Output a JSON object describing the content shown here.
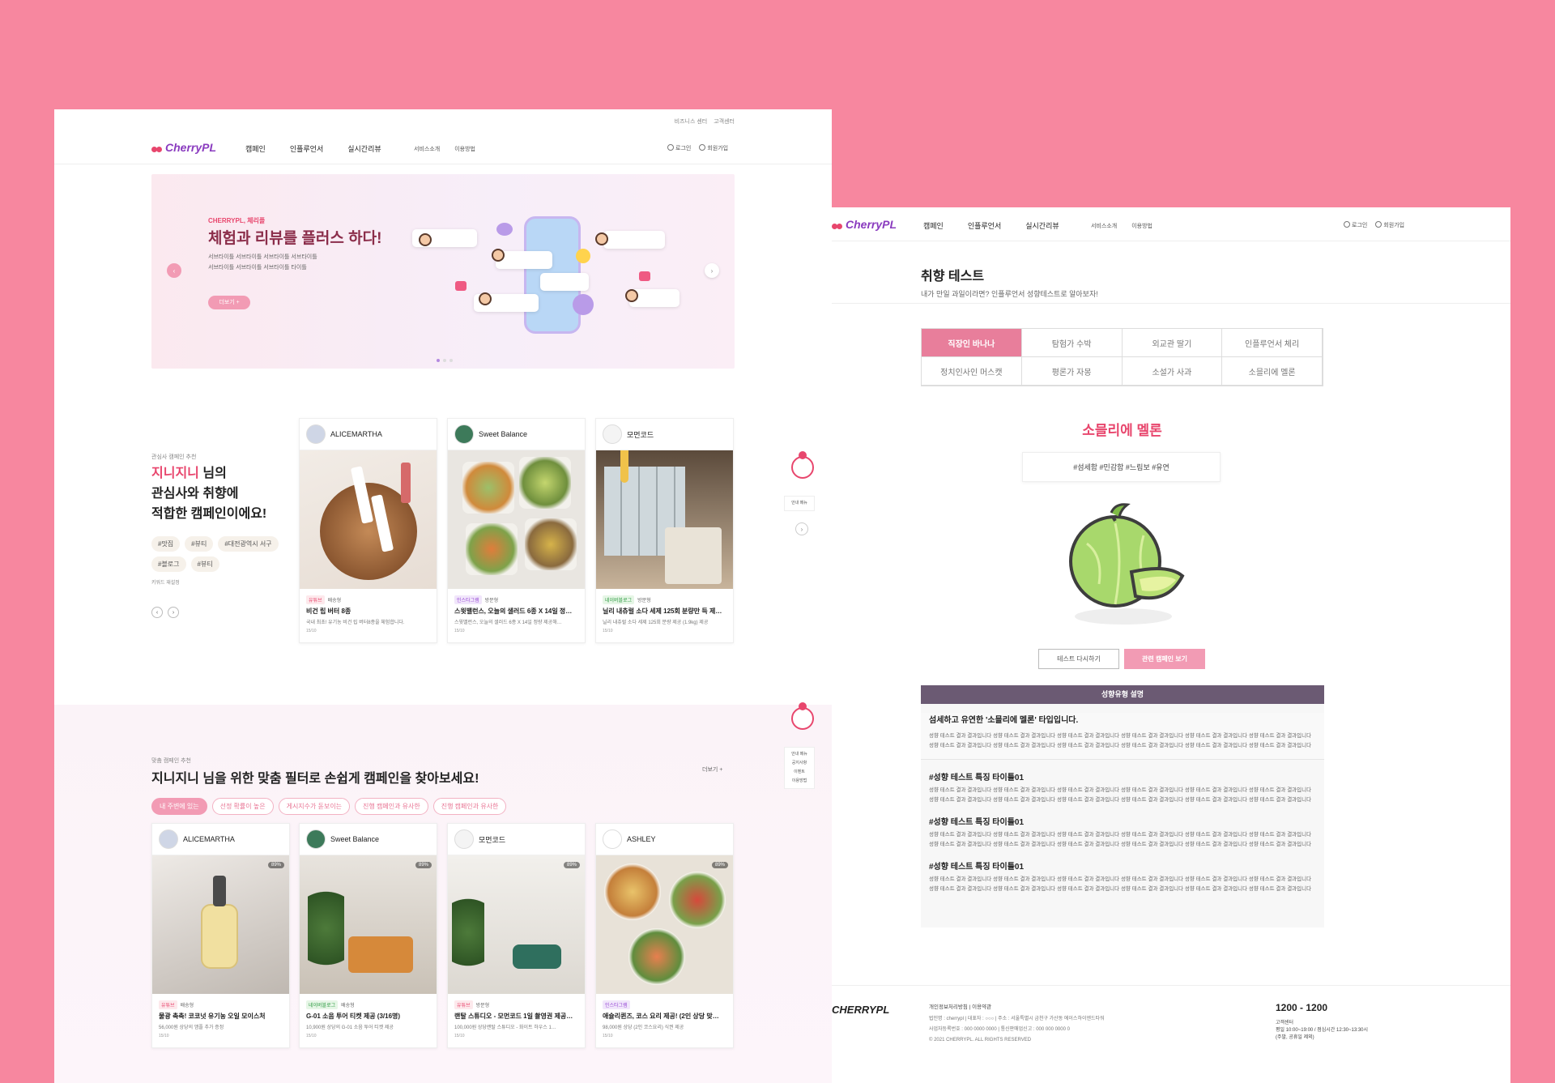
{
  "colors": {
    "background": "#f7879f",
    "accent": "#e8466d",
    "accent_light": "#f29bb4",
    "section_header": "#6b5a73"
  },
  "main_page": {
    "util_links": [
      "비즈니스 센터",
      "고객센터"
    ],
    "logo": "CherryPL",
    "nav": [
      "캠페인",
      "인플루언서",
      "실시간리뷰"
    ],
    "subnav": [
      "서비스소개",
      "이용방법"
    ],
    "auth": {
      "login": "로그인",
      "signup": "회원가입"
    },
    "banner": {
      "eyebrow": "CHERRYPL, 체리플",
      "title": "체험과 리뷰를 플러스 하다!",
      "desc_line1": "서브타이틀 서브타이틀 서브타이틀 서브타이틀",
      "desc_line2": "서브타이틀 서브타이틀 서브타이틀 타이틀",
      "more_button": "더보기 +"
    },
    "recommend": {
      "caption": "관심사 캠페인 추천",
      "name": "지니지니",
      "title_suffix": "님의",
      "title_line2": "관심사와 취향에",
      "title_line3": "적합한 캠페인이에요!",
      "chips": [
        "#맛집",
        "#뷰티",
        "#대전광역시 서구",
        "#블로그",
        "#뷰티"
      ],
      "reset_link": "키워드 재설정",
      "cards": [
        {
          "brand": "ALICEMARTHA",
          "badge": "유튜브",
          "type": "배송형",
          "title": "비건 립 버터 8종",
          "sub": "국내 최초! 유기농 비건 립 버터8종을 체험합니다.",
          "meta": "15/10"
        },
        {
          "brand": "Sweet Balance",
          "badge": "인스타그램",
          "type": "방문형",
          "title": "스윗밸런스, 오늘의 샐러드 6종 X 14일 정…",
          "sub": "스윗밸런스, 오늘의 샐러드 6종 X 14일 정량 제공해…",
          "meta": "15/10"
        },
        {
          "brand": "모먼코드",
          "badge": "네이버블로그",
          "type": "방문형",
          "title": "닐리 내츄럴 소다 세제 125회 분량만 득 제공…",
          "sub": "닐리 내츄럴 소다 세제 125회 분량 제공 (1.9kg) 제공",
          "meta": "15/10"
        }
      ]
    },
    "side_menu_label": "안내 메뉴",
    "side_menu_items": [
      "공지사항",
      "이벤트",
      "이용방법"
    ],
    "filter_section": {
      "caption": "맞춤 캠페인 추천",
      "title": "지니지니 님을 위한 맞춤 필터로 손쉽게 캠페인을 찾아보세요!",
      "more": "더보기 +",
      "filters": [
        "내 주변에 있는",
        "선정 확률이 높은",
        "게시지수가 돋보이는",
        "진행 캠페인과 유사한",
        "진행 캠페인과 유사한"
      ],
      "cards": [
        {
          "brand": "ALICEMARTHA",
          "pct": "89%",
          "badge": "유튜브",
          "type": "배송형",
          "title": "물광 촉촉! 코코넛 유기농 오일 모이스처",
          "sub": "56,000원 상당의 앰플 추가 증정",
          "meta": "15/10"
        },
        {
          "brand": "Sweet Balance",
          "pct": "89%",
          "badge": "네이버블로그",
          "type": "배송형",
          "title": "G-01 소음 투어 티켓 제공 (3/16명)",
          "sub": "10,900원 상당의 G-01 소음 투어 티켓 제공",
          "meta": "15/10"
        },
        {
          "brand": "모먼코드",
          "pct": "89%",
          "badge": "유튜브",
          "type": "방문형",
          "title": "랜탈 스튜디오 - 모먼코드 1일 촬영권 제공…",
          "sub": "100,000원 상당랜탈 스튜디오 - 화이트 하우스 1…",
          "meta": "15/10"
        },
        {
          "brand": "ASHLEY",
          "pct": "89%",
          "badge": "인스타그램",
          "type": "",
          "title": "애슐리퀸즈, 코스 요리 제공! (2인 상당 맞…",
          "sub": "98,000원 상당 (2인 코스요리) 식권 제공",
          "meta": "15/10"
        }
      ]
    }
  },
  "test_page": {
    "logo": "CherryPL",
    "nav": [
      "캠페인",
      "인플루언서",
      "실시간리뷰"
    ],
    "subnav": [
      "서비스소개",
      "이용방법"
    ],
    "auth": {
      "login": "로그인",
      "signup": "회원가입"
    },
    "title": "취향 테스트",
    "subtitle": "내가 만일 과일이라면? 인플루언서 성향테스트로 알아보자!",
    "tabs": [
      "직장인 바나나",
      "탐험가 수박",
      "외교관 딸기",
      "인플루언서 체리",
      "정치인사인 머스캣",
      "평론가 자몽",
      "소설가 사과",
      "소믈리에 멜론"
    ],
    "result_name": "소믈리에 멜론",
    "hashtags": "#섬세함 #민감함 #느림보 #유연",
    "retry_button": "테스트 다시하기",
    "related_button": "관련 캠페인 보기",
    "desc_header": "성향유형 설명",
    "type_headline": "섬세하고 유연한 '소믈리에 멜론' 타입입니다.",
    "body_text": "성향 테스트 결과 결과입니다 성향 테스트 결과 결과입니다 성향 테스트 결과 결과입니다 성향 테스트 결과 결과입니다 성향 테스트 결과 결과입니다 성향 테스트 결과 결과입니다 성향 테스트 결과 결과입니다 성향 테스트 결과 결과입니다 성향 테스트 결과 결과입니다 성향 테스트 결과 결과입니다 성향 테스트 결과 결과입니다 성향 테스트 결과 결과입니다",
    "sections": [
      "#성향 테스트 특징 타이틀01",
      "#성향 테스트 특징 타이틀01",
      "#성향 테스트 특징 타이틀01"
    ],
    "footer": {
      "logo": "CHERRYPL",
      "links": "개인정보처리방침 | 이용약관",
      "info1": "법인명 : cherrypl | 대표자 : ○○○ | 주소 : 서울특별시 금천구 가산동 에이스하이엔드타워",
      "info2": "사업자등록번호 : 000 0000 0000 | 통신판매업신고 : 000 000 0000 0",
      "copyright": "© 2021 CHERRYPL. ALL RIGHTS RESERVED",
      "tel": "1200 - 1200",
      "cs_label": "고객센터",
      "cs_hours1": "평일 10:00~19:00 / 점심시간 12:30~13:30시",
      "cs_hours2": "(주말, 공휴일 제외)"
    }
  }
}
